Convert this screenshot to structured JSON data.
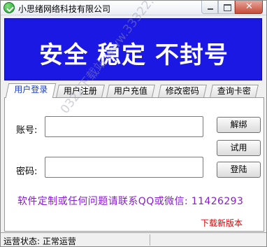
{
  "window": {
    "title": "小思绪网络科技有限公司",
    "close_symbol": "✕"
  },
  "banner": {
    "text": "安全 稳定 不封号",
    "color": "#1b18e3"
  },
  "tabs": [
    {
      "label": "用户登录",
      "active": true
    },
    {
      "label": "用户注册",
      "active": false
    },
    {
      "label": "用户充值",
      "active": false
    },
    {
      "label": "修改密码",
      "active": false
    },
    {
      "label": "查询卡密",
      "active": false
    }
  ],
  "form": {
    "account_label": "账号:",
    "account_value": "",
    "password_label": "密码:",
    "password_value": ""
  },
  "buttons": {
    "unbind": "解绑",
    "trial": "试用",
    "login": "登陆"
  },
  "promo": {
    "text": "软件定制或任何问题请联系QQ或微信: 11426293",
    "color": "#8a1ccf"
  },
  "download": {
    "text": "下载新版本",
    "color": "#e00000"
  },
  "watermark": {
    "text": "0322下载站 www.33322.cc"
  },
  "status": {
    "text": "运营状态: 正常运营"
  }
}
